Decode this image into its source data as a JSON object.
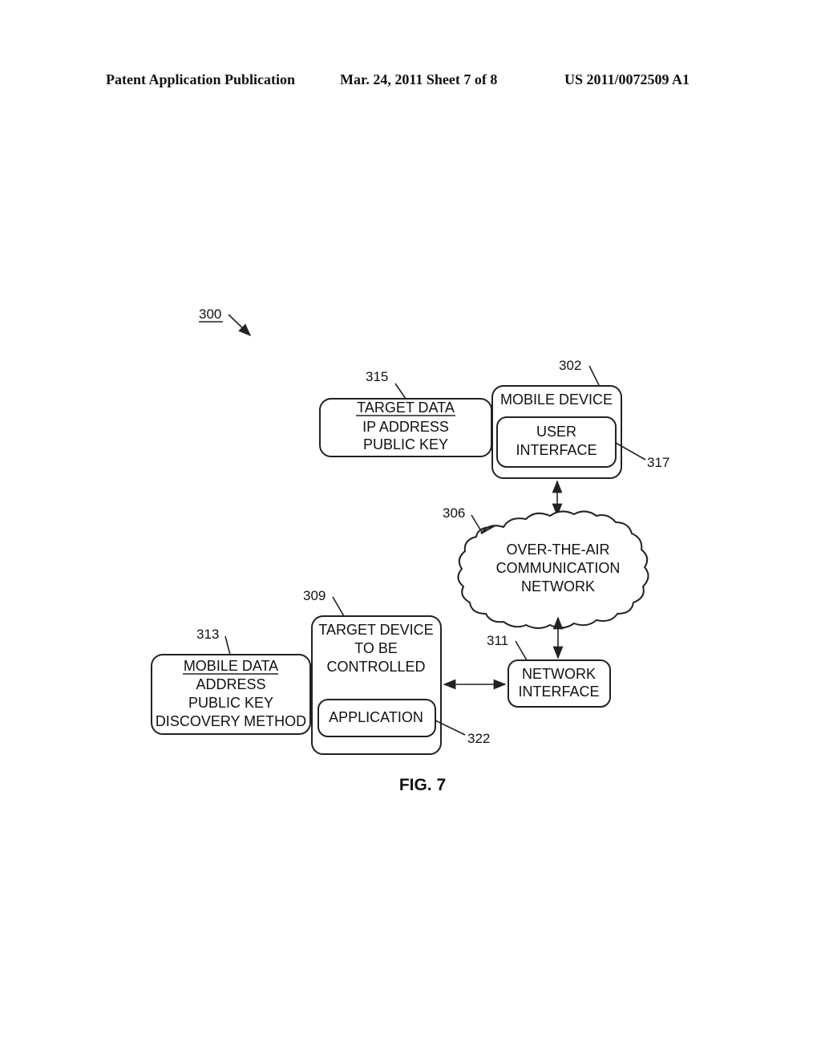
{
  "header": {
    "left": "Patent Application Publication",
    "center": "Mar. 24, 2011  Sheet 7 of 8",
    "right": "US 2011/0072509 A1"
  },
  "figure": {
    "ref_overall": "300",
    "caption": "FIG. 7",
    "target_data": {
      "ref": "315",
      "title": "TARGET DATA",
      "lines": [
        "IP ADDRESS",
        "PUBLIC KEY"
      ]
    },
    "mobile_device": {
      "ref": "302",
      "title": "MOBILE DEVICE"
    },
    "user_interface": {
      "ref": "317",
      "lines": [
        "USER",
        "INTERFACE"
      ]
    },
    "network": {
      "ref": "306",
      "lines": [
        "OVER-THE-AIR",
        "COMMUNICATION",
        "NETWORK"
      ]
    },
    "target_device": {
      "ref": "309",
      "lines": [
        "TARGET DEVICE",
        "TO BE",
        "CONTROLLED"
      ]
    },
    "application": {
      "ref": "322",
      "label": "APPLICATION"
    },
    "mobile_data": {
      "ref": "313",
      "title": "MOBILE DATA",
      "lines": [
        "ADDRESS",
        "PUBLIC KEY",
        "DISCOVERY METHOD"
      ]
    },
    "network_interface": {
      "ref": "311",
      "lines": [
        "NETWORK",
        "INTERFACE"
      ]
    }
  }
}
